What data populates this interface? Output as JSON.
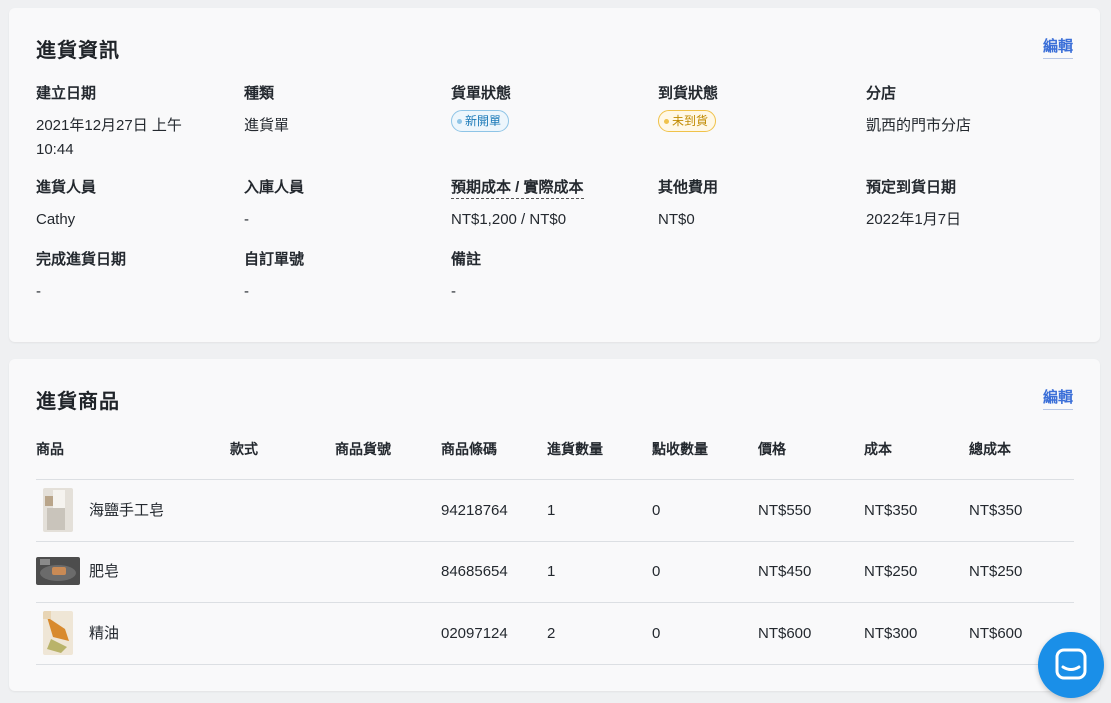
{
  "info_card": {
    "title": "進貨資訊",
    "edit_label": "編輯",
    "fields": {
      "created_date": {
        "label": "建立日期",
        "value": "2021年12月27日 上午10:44"
      },
      "type": {
        "label": "種類",
        "value": "進貨單"
      },
      "order_status": {
        "label": "貨單狀態",
        "value": "新開單"
      },
      "arrival_status": {
        "label": "到貨狀態",
        "value": "未到貨"
      },
      "branch": {
        "label": "分店",
        "value": "凱西的門市分店"
      },
      "purchaser": {
        "label": "進貨人員",
        "value": "Cathy"
      },
      "receiver": {
        "label": "入庫人員",
        "value": "-"
      },
      "cost": {
        "label": "預期成本 / 實際成本",
        "value": "NT$1,200 / NT$0"
      },
      "other_fees": {
        "label": "其他費用",
        "value": "NT$0"
      },
      "expected_arrival": {
        "label": "預定到貨日期",
        "value": "2022年1月7日"
      },
      "completed_date": {
        "label": "完成進貨日期",
        "value": "-"
      },
      "custom_number": {
        "label": "自訂單號",
        "value": "-"
      },
      "remarks": {
        "label": "備註",
        "value": "-"
      }
    }
  },
  "products_card": {
    "title": "進貨商品",
    "edit_label": "編輯",
    "columns": [
      "商品",
      "款式",
      "商品貨號",
      "商品條碼",
      "進貨數量",
      "點收數量",
      "價格",
      "成本",
      "總成本"
    ],
    "rows": [
      {
        "name": "海鹽手工皂",
        "variant": "",
        "sku": "",
        "barcode": "94218764",
        "qty": "1",
        "received": "0",
        "price": "NT$550",
        "cost": "NT$350",
        "total": "NT$350",
        "thumb": "soap-bar-image"
      },
      {
        "name": "肥皂",
        "variant": "",
        "sku": "",
        "barcode": "84685654",
        "qty": "1",
        "received": "0",
        "price": "NT$450",
        "cost": "NT$250",
        "total": "NT$250",
        "thumb": "soap-dish-image"
      },
      {
        "name": "精油",
        "variant": "",
        "sku": "",
        "barcode": "02097124",
        "qty": "2",
        "received": "0",
        "price": "NT$600",
        "cost": "NT$300",
        "total": "NT$600",
        "thumb": "essential-oil-image"
      }
    ]
  },
  "chat_widget": {
    "icon": "chat-bubble-icon",
    "color": "#1a8fe8"
  },
  "colors": {
    "accent": "#3b6fd8",
    "badge_new": "#1b79b8",
    "badge_pending": "#c08a00"
  }
}
